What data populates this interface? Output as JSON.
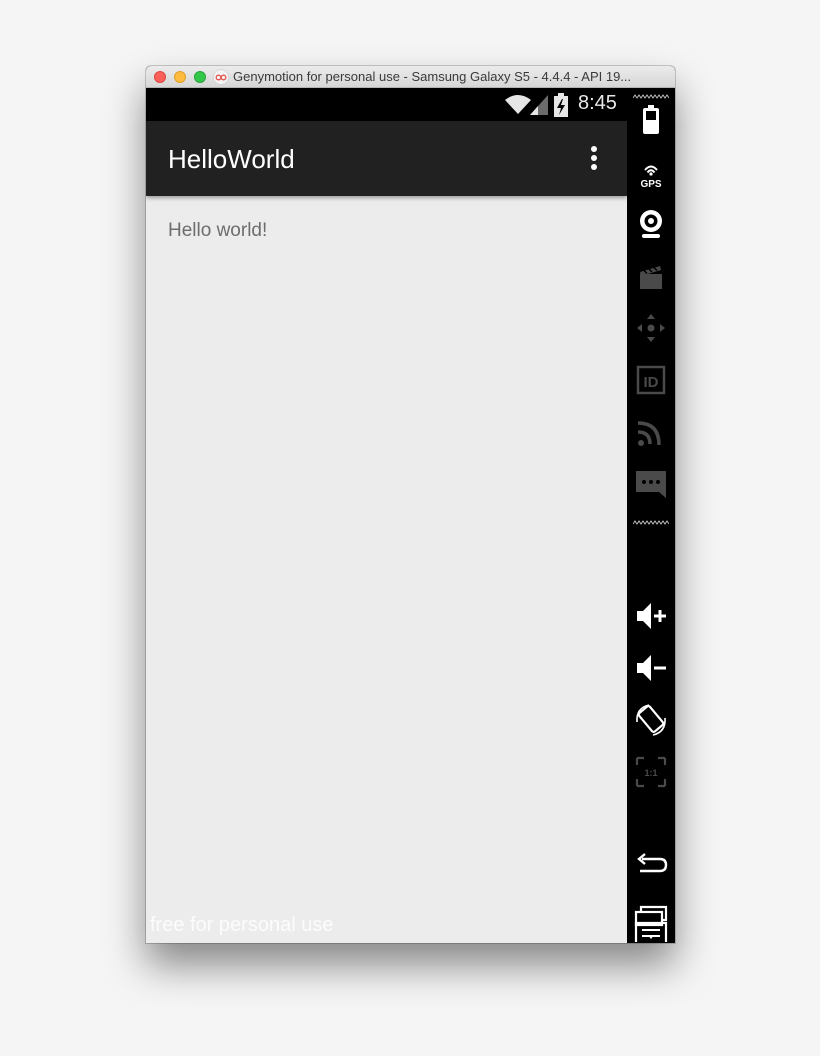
{
  "window": {
    "title": "Genymotion for personal use - Samsung Galaxy S5 - 4.4.4 - API 19..."
  },
  "status_bar": {
    "time": "8:45",
    "icons": [
      "wifi-icon",
      "signal-icon",
      "battery-charging-icon"
    ]
  },
  "action_bar": {
    "title": "HelloWorld",
    "overflow_icon": "overflow-menu-icon"
  },
  "content": {
    "text": "Hello world!"
  },
  "watermark": "free for personal use",
  "sidebar": {
    "top_tools": [
      {
        "name": "battery-icon",
        "label": ""
      },
      {
        "name": "gps-icon",
        "label": "GPS"
      },
      {
        "name": "webcam-icon",
        "label": ""
      },
      {
        "name": "capture-icon",
        "label": ""
      },
      {
        "name": "dpad-icon",
        "label": ""
      },
      {
        "name": "device-id-icon",
        "label": "ID"
      },
      {
        "name": "network-icon",
        "label": ""
      },
      {
        "name": "phone-sms-icon",
        "label": ""
      }
    ],
    "controls": [
      {
        "name": "volume-up-icon"
      },
      {
        "name": "volume-down-icon"
      },
      {
        "name": "rotate-icon"
      },
      {
        "name": "pixel-perfect-icon",
        "label": "1:1"
      }
    ],
    "nav": [
      {
        "name": "back-icon"
      },
      {
        "name": "recent-apps-icon"
      },
      {
        "name": "menu-icon"
      }
    ]
  },
  "colors": {
    "action_bar": "#212121",
    "screen_background": "#ececec",
    "status_bar": "#000000"
  }
}
